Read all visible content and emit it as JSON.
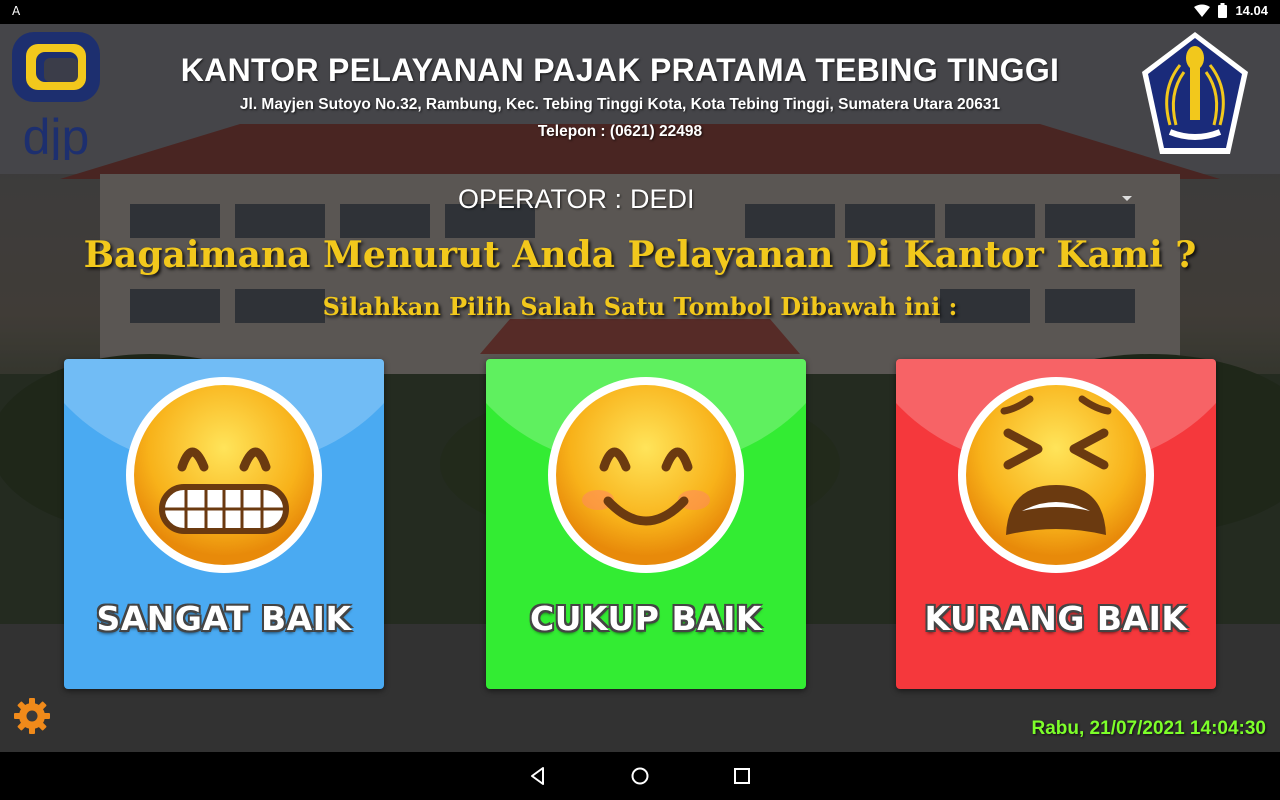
{
  "status_bar": {
    "left_indicator": "A",
    "time": "14.04",
    "icons": [
      "wifi-icon",
      "battery-icon"
    ]
  },
  "header": {
    "logo_left_text": "djp",
    "title": "KANTOR PELAYANAN PAJAK PRATAMA TEBING TINGGI",
    "address": "Jl. Mayjen Sutoyo No.32, Rambung, Kec. Tebing Tinggi Kota, Kota Tebing Tinggi, Sumatera Utara 20631",
    "phone": "Telepon :  (0621) 22498"
  },
  "operator": {
    "label": "OPERATOR :",
    "value": "DEDI"
  },
  "survey": {
    "question": "Bagaimana Menurut Anda Pelayanan Di Kantor Kami ?",
    "instruction": "Silahkan Pilih Salah Satu Tombol Dibawah ini :",
    "options": [
      {
        "label": "SANGAT BAIK",
        "color": "#4aaaf2",
        "icon": "grinning-face-icon"
      },
      {
        "label": "CUKUP BAIK",
        "color": "#33ec33",
        "icon": "smiling-face-icon"
      },
      {
        "label": "KURANG BAIK",
        "color": "#f5383c",
        "icon": "tired-face-icon"
      }
    ]
  },
  "footer": {
    "datetime": "Rabu, 21/07/2021 14:04:30",
    "datetime_color": "#7dff2a"
  },
  "nav": [
    "back-icon",
    "home-icon",
    "recents-icon"
  ]
}
